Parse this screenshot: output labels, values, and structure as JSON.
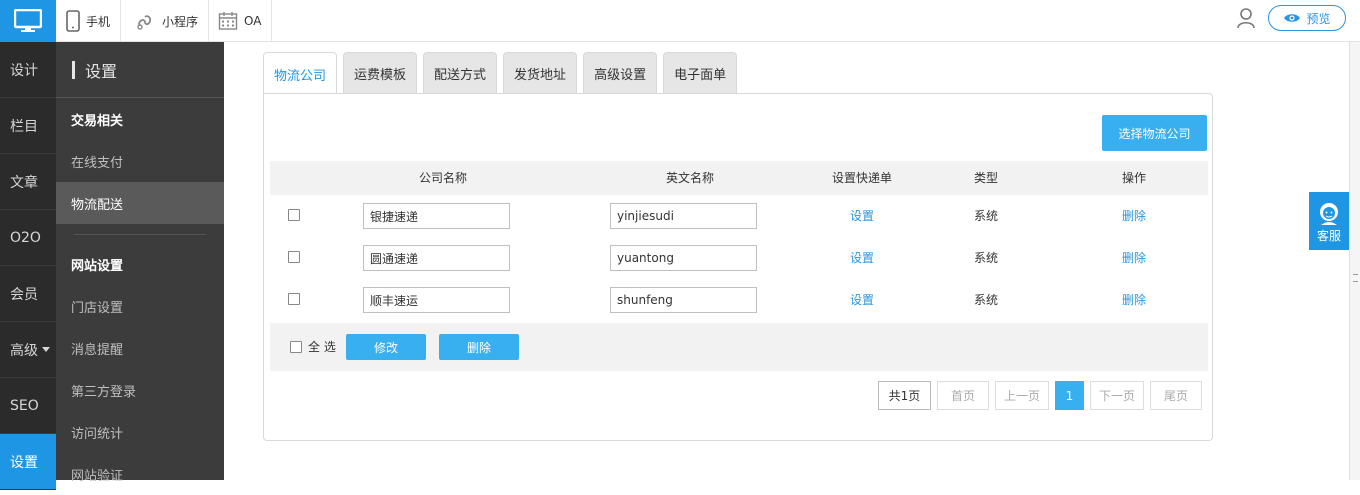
{
  "topbar": {
    "tabs": [
      {
        "label": "手机",
        "icon": "phone-icon"
      },
      {
        "label": "小程序",
        "icon": "mini-program-icon"
      },
      {
        "label": "OA",
        "icon": "calendar-icon"
      }
    ],
    "preview_label": "预览"
  },
  "leftnav": {
    "items": [
      {
        "label": "设计"
      },
      {
        "label": "栏目"
      },
      {
        "label": "文章"
      },
      {
        "label": "O2O"
      },
      {
        "label": "会员"
      },
      {
        "label": "高级"
      },
      {
        "label": "SEO"
      },
      {
        "label": "设置"
      }
    ]
  },
  "subnav": {
    "title": "设置",
    "group1": "交易相关",
    "group1_items": [
      "在线支付",
      "物流配送"
    ],
    "group2": "网站设置",
    "group2_items": [
      "门店设置",
      "消息提醒",
      "第三方登录",
      "访问统计",
      "网站验证"
    ]
  },
  "tabs": [
    "物流公司",
    "运费模板",
    "配送方式",
    "发货地址",
    "高级设置",
    "电子面单"
  ],
  "panel": {
    "select_button": "选择物流公司",
    "headers": {
      "name": "公司名称",
      "en_name": "英文名称",
      "waybill": "设置快递单",
      "type": "类型",
      "action": "操作"
    },
    "rows": [
      {
        "name": "银捷速递",
        "en_name": "yinjiesudi",
        "waybill": "设置",
        "type": "系统",
        "action": "删除"
      },
      {
        "name": "圆通速递",
        "en_name": "yuantong",
        "waybill": "设置",
        "type": "系统",
        "action": "删除"
      },
      {
        "name": "顺丰速运",
        "en_name": "shunfeng",
        "waybill": "设置",
        "type": "系统",
        "action": "删除"
      }
    ],
    "footer": {
      "select_all": "全 选",
      "edit": "修改",
      "delete": "删除"
    },
    "pager": {
      "total": "共1页",
      "first": "首页",
      "prev": "上一页",
      "current": "1",
      "next": "下一页",
      "last": "尾页"
    }
  },
  "kefu_label": "客服",
  "colors": {
    "accent": "#1e96e4",
    "button": "#38b0f0",
    "link": "#2a95e0"
  }
}
